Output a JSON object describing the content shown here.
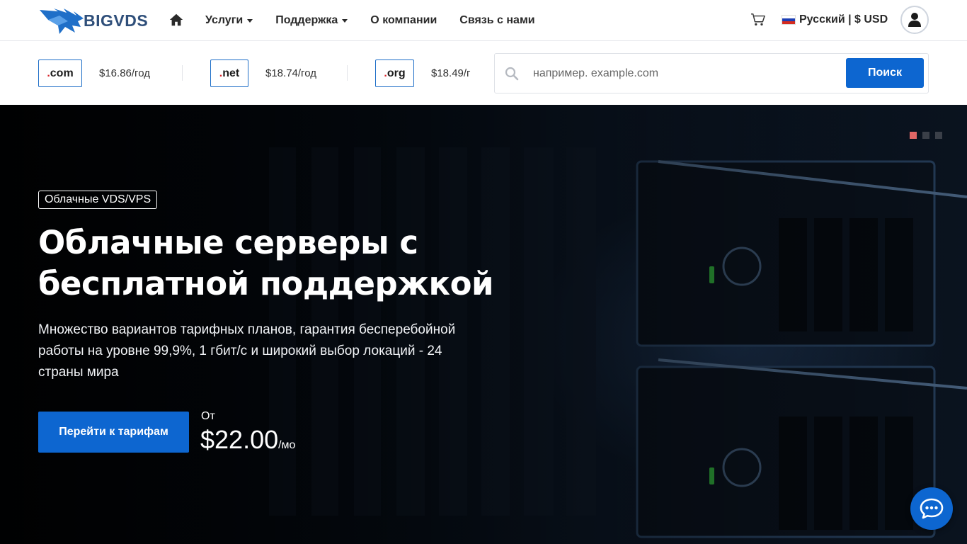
{
  "header": {
    "brand": "BIGVDS",
    "nav": [
      {
        "label": "Услуги",
        "dropdown": true
      },
      {
        "label": "Поддержка",
        "dropdown": true
      },
      {
        "label": "О компании",
        "dropdown": false
      },
      {
        "label": "Связь с нами",
        "dropdown": false
      }
    ],
    "language_currency": "Русский | $ USD",
    "icons": {
      "home": "home-icon",
      "cart": "cart-icon",
      "user": "user-icon",
      "flag": "russia-flag-icon"
    }
  },
  "domains": {
    "items": [
      {
        "tld": "com",
        "price": "$16.86/год"
      },
      {
        "tld": "net",
        "price": "$18.74/год"
      },
      {
        "tld": "org",
        "price": "$18.49/г"
      }
    ],
    "search": {
      "placeholder": "например. example.com",
      "value": "",
      "button": "Поиск"
    }
  },
  "hero": {
    "badge": "Облачные VDS/VPS",
    "title_line1": "Облачные серверы с",
    "title_line2": "бесплатной поддержкой",
    "subtitle": "Множество вариантов тарифных планов, гарантия бесперебойной работы на уровне 99,9%, 1 гбит/с и широкий выбор локаций - 24 страны мира",
    "cta": "Перейти к тарифам",
    "from_label": "От",
    "price": "$22.00",
    "price_period": "/мо",
    "slides": {
      "count": 3,
      "active": 1
    }
  },
  "colors": {
    "accent": "#0d66d0",
    "brand": "#2f4f7a",
    "tld_dot": "#d9262c",
    "slide_active": "#e06666"
  },
  "chat": {
    "icon": "chat-bubble-icon"
  }
}
